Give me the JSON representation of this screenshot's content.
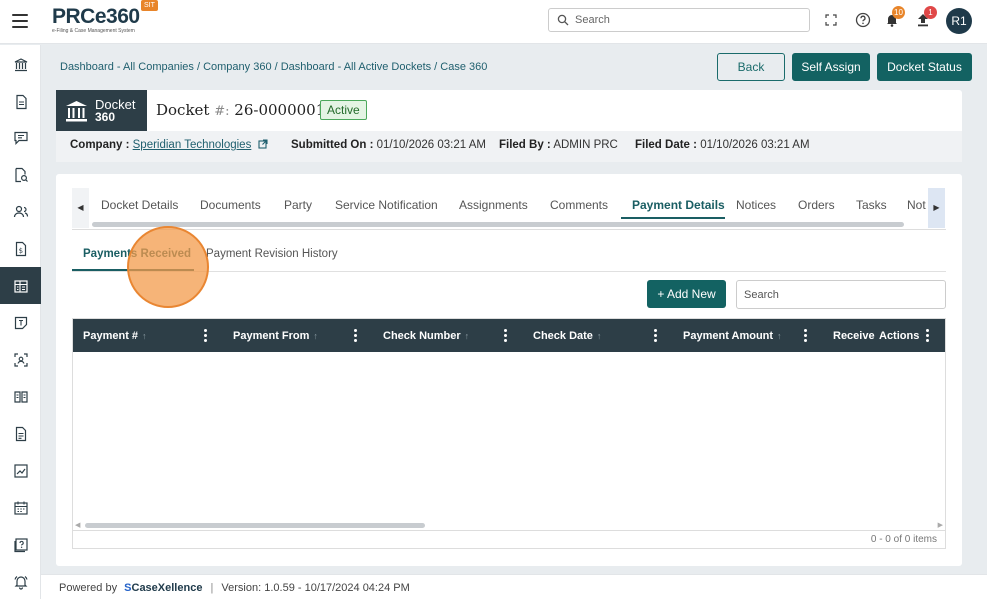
{
  "header": {
    "logo_text": "PRCe360",
    "logo_subtitle": "e-Filing & Case Management System",
    "env_badge": "SIT",
    "search_placeholder": "Search",
    "notifications_count": "10",
    "uploads_count": "1",
    "avatar_initials": "R1"
  },
  "breadcrumb": "Dashboard - All Companies / Company 360 / Dashboard - All Active Dockets / Case 360",
  "actions": {
    "back": "Back",
    "self_assign": "Self Assign",
    "docket_status": "Docket Status"
  },
  "docket": {
    "tag_line1": "Docket",
    "tag_line2": "360",
    "title_prefix": "Docket",
    "title_hash": "#:",
    "number": "26-0000001",
    "status": "Active",
    "company_label": "Company :",
    "company_value": "Speridian Technologies",
    "submitted_label": "Submitted On :",
    "submitted_value": "01/10/2026 03:21 AM",
    "filed_by_label": "Filed By :",
    "filed_by_value": "ADMIN PRC",
    "filed_date_label": "Filed Date :",
    "filed_date_value": "01/10/2026 03:21 AM"
  },
  "tabs": [
    "Docket Details",
    "Documents",
    "Party",
    "Service Notification",
    "Assignments",
    "Comments",
    "Payment Details",
    "Notices",
    "Orders",
    "Tasks",
    "Not"
  ],
  "active_tab": "Payment Details",
  "subtabs": [
    "Payments Received",
    "Payment Revision History"
  ],
  "active_subtab": "Payments Received",
  "grid": {
    "add_button": "+ Add New",
    "search_placeholder": "Search",
    "columns": [
      "Payment #",
      "Payment From",
      "Check Number",
      "Check Date",
      "Payment Amount",
      "Receive",
      "Actions"
    ],
    "pager": "0 - 0 of 0 items"
  },
  "footer": {
    "powered_by": "Powered by",
    "brand": "CaseXellence",
    "version": "Version: 1.0.59 - 10/17/2024 04:24 PM"
  },
  "colors": {
    "primary": "#136262",
    "dark": "#2d3e47",
    "accent_orange": "#e98632",
    "badge_red": "#e04848"
  }
}
